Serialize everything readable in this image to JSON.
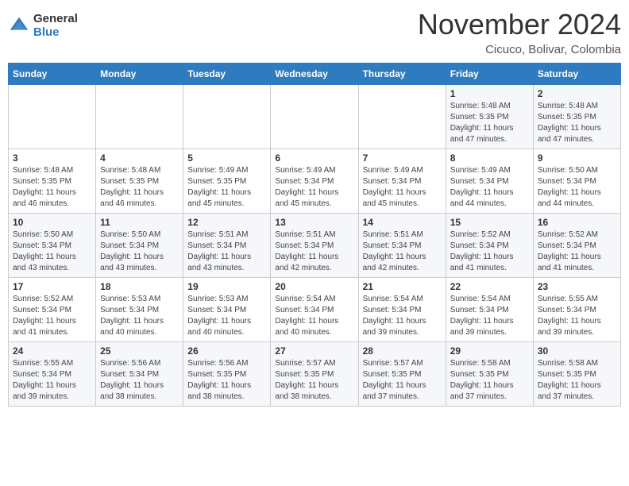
{
  "header": {
    "logo": {
      "line1": "General",
      "line2": "Blue"
    },
    "title": "November 2024",
    "location": "Cicuco, Bolivar, Colombia"
  },
  "days_of_week": [
    "Sunday",
    "Monday",
    "Tuesday",
    "Wednesday",
    "Thursday",
    "Friday",
    "Saturday"
  ],
  "weeks": [
    [
      {
        "day": "",
        "content": ""
      },
      {
        "day": "",
        "content": ""
      },
      {
        "day": "",
        "content": ""
      },
      {
        "day": "",
        "content": ""
      },
      {
        "day": "",
        "content": ""
      },
      {
        "day": "1",
        "content": "Sunrise: 5:48 AM\nSunset: 5:35 PM\nDaylight: 11 hours and 47 minutes."
      },
      {
        "day": "2",
        "content": "Sunrise: 5:48 AM\nSunset: 5:35 PM\nDaylight: 11 hours and 47 minutes."
      }
    ],
    [
      {
        "day": "3",
        "content": "Sunrise: 5:48 AM\nSunset: 5:35 PM\nDaylight: 11 hours and 46 minutes."
      },
      {
        "day": "4",
        "content": "Sunrise: 5:48 AM\nSunset: 5:35 PM\nDaylight: 11 hours and 46 minutes."
      },
      {
        "day": "5",
        "content": "Sunrise: 5:49 AM\nSunset: 5:35 PM\nDaylight: 11 hours and 45 minutes."
      },
      {
        "day": "6",
        "content": "Sunrise: 5:49 AM\nSunset: 5:34 PM\nDaylight: 11 hours and 45 minutes."
      },
      {
        "day": "7",
        "content": "Sunrise: 5:49 AM\nSunset: 5:34 PM\nDaylight: 11 hours and 45 minutes."
      },
      {
        "day": "8",
        "content": "Sunrise: 5:49 AM\nSunset: 5:34 PM\nDaylight: 11 hours and 44 minutes."
      },
      {
        "day": "9",
        "content": "Sunrise: 5:50 AM\nSunset: 5:34 PM\nDaylight: 11 hours and 44 minutes."
      }
    ],
    [
      {
        "day": "10",
        "content": "Sunrise: 5:50 AM\nSunset: 5:34 PM\nDaylight: 11 hours and 43 minutes."
      },
      {
        "day": "11",
        "content": "Sunrise: 5:50 AM\nSunset: 5:34 PM\nDaylight: 11 hours and 43 minutes."
      },
      {
        "day": "12",
        "content": "Sunrise: 5:51 AM\nSunset: 5:34 PM\nDaylight: 11 hours and 43 minutes."
      },
      {
        "day": "13",
        "content": "Sunrise: 5:51 AM\nSunset: 5:34 PM\nDaylight: 11 hours and 42 minutes."
      },
      {
        "day": "14",
        "content": "Sunrise: 5:51 AM\nSunset: 5:34 PM\nDaylight: 11 hours and 42 minutes."
      },
      {
        "day": "15",
        "content": "Sunrise: 5:52 AM\nSunset: 5:34 PM\nDaylight: 11 hours and 41 minutes."
      },
      {
        "day": "16",
        "content": "Sunrise: 5:52 AM\nSunset: 5:34 PM\nDaylight: 11 hours and 41 minutes."
      }
    ],
    [
      {
        "day": "17",
        "content": "Sunrise: 5:52 AM\nSunset: 5:34 PM\nDaylight: 11 hours and 41 minutes."
      },
      {
        "day": "18",
        "content": "Sunrise: 5:53 AM\nSunset: 5:34 PM\nDaylight: 11 hours and 40 minutes."
      },
      {
        "day": "19",
        "content": "Sunrise: 5:53 AM\nSunset: 5:34 PM\nDaylight: 11 hours and 40 minutes."
      },
      {
        "day": "20",
        "content": "Sunrise: 5:54 AM\nSunset: 5:34 PM\nDaylight: 11 hours and 40 minutes."
      },
      {
        "day": "21",
        "content": "Sunrise: 5:54 AM\nSunset: 5:34 PM\nDaylight: 11 hours and 39 minutes."
      },
      {
        "day": "22",
        "content": "Sunrise: 5:54 AM\nSunset: 5:34 PM\nDaylight: 11 hours and 39 minutes."
      },
      {
        "day": "23",
        "content": "Sunrise: 5:55 AM\nSunset: 5:34 PM\nDaylight: 11 hours and 39 minutes."
      }
    ],
    [
      {
        "day": "24",
        "content": "Sunrise: 5:55 AM\nSunset: 5:34 PM\nDaylight: 11 hours and 39 minutes."
      },
      {
        "day": "25",
        "content": "Sunrise: 5:56 AM\nSunset: 5:34 PM\nDaylight: 11 hours and 38 minutes."
      },
      {
        "day": "26",
        "content": "Sunrise: 5:56 AM\nSunset: 5:35 PM\nDaylight: 11 hours and 38 minutes."
      },
      {
        "day": "27",
        "content": "Sunrise: 5:57 AM\nSunset: 5:35 PM\nDaylight: 11 hours and 38 minutes."
      },
      {
        "day": "28",
        "content": "Sunrise: 5:57 AM\nSunset: 5:35 PM\nDaylight: 11 hours and 37 minutes."
      },
      {
        "day": "29",
        "content": "Sunrise: 5:58 AM\nSunset: 5:35 PM\nDaylight: 11 hours and 37 minutes."
      },
      {
        "day": "30",
        "content": "Sunrise: 5:58 AM\nSunset: 5:35 PM\nDaylight: 11 hours and 37 minutes."
      }
    ]
  ]
}
